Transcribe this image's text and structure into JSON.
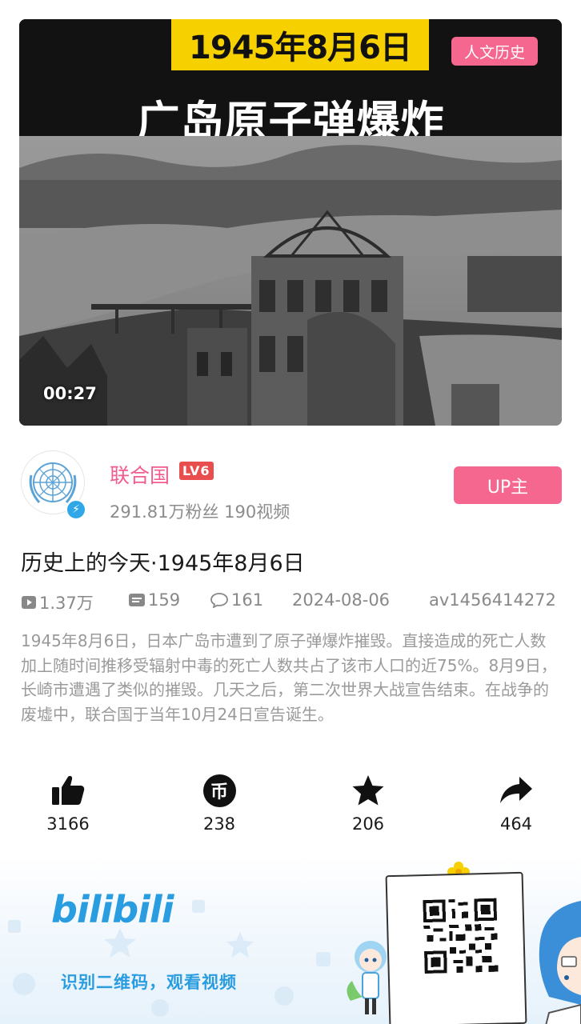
{
  "video": {
    "banner_date": "1945年8月6日",
    "banner_title": "广岛原子弹爆炸",
    "category_tag": "人文历史",
    "duration": "00:27"
  },
  "author": {
    "name": "联合国",
    "level": "LV6",
    "stats": "291.81万粉丝  190视频",
    "up_button": "UP主"
  },
  "title": "历史上的今天·1945年8月6日",
  "meta": {
    "views": "1.37万",
    "danmaku": "159",
    "comments": "161",
    "date": "2024-08-06",
    "av_id": "av1456414272"
  },
  "description": "1945年8月6日，日本广岛市遭到了原子弹爆炸摧毁。直接造成的死亡人数加上随时间推移受辐射中毒的死亡人数共占了该市人口的近75%。8月9日，长崎市遭遇了类似的摧毁。几天之后，第二次世界大战宣告结束。在战争的废墟中，联合国于当年10月24日宣告诞生。",
  "actions": {
    "like_count": "3166",
    "coin_count": "238",
    "coin_glyph": "币",
    "favorite_count": "206",
    "share_count": "464"
  },
  "banner": {
    "logo_text": "bilibili",
    "caption": "识别二维码，观看视频"
  },
  "colors": {
    "pink": "#f5678f",
    "author_pink": "#f25d8e",
    "brand_blue": "#2a9de0",
    "banner_yellow": "#f7d000"
  }
}
